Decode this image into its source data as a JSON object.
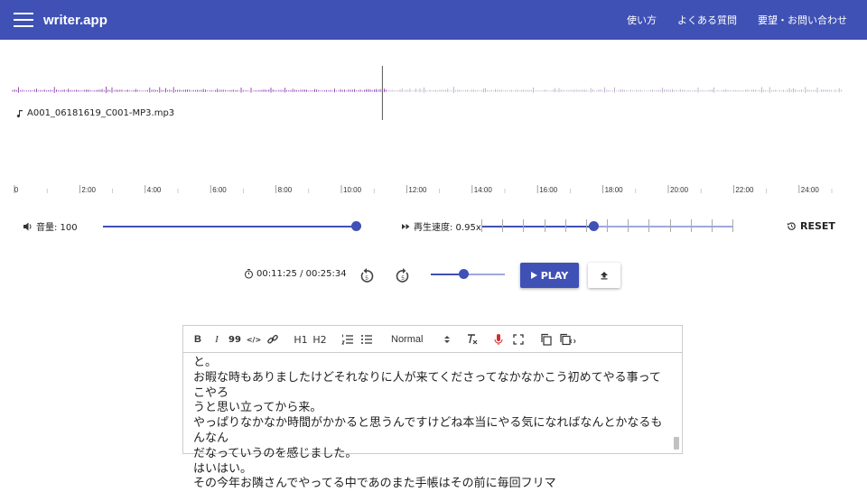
{
  "appbar": {
    "brand": "writer.app",
    "nav": [
      "使い方",
      "よくある質問",
      "要望・お問い合わせ"
    ]
  },
  "player": {
    "filename": "A001_06181619_C001-MP3.mp3",
    "timeline_labels": [
      "0",
      "2:00",
      "4:00",
      "6:00",
      "8:00",
      "10:00",
      "12:00",
      "14:00",
      "16:00",
      "18:00",
      "20:00",
      "22:00",
      "24:00"
    ],
    "volume_label": "音量: 100",
    "volume_value": 100,
    "speed_label": "再生速度: 0.95x",
    "speed_value": 0.95,
    "reset_label": "RESET",
    "time_display": "00:11:25 / 00:25:34",
    "play_label": "PLAY",
    "playhead_position": 0.446,
    "mini_slider_value": 0.44
  },
  "editor": {
    "toolbar": {
      "bold": "B",
      "italic": "I",
      "quote": "99",
      "code": "</>",
      "h1": "H1",
      "h2": "H2",
      "format_select": "Normal"
    },
    "lines": [
      "と。",
      "お暇な時もありましたけどそれなりに人が来てくださってなかなかこう初めてやる事ってこやろ",
      "うと思い立ってから来。",
      "やっぱりなかなか時間がかかると思うんですけどね本当にやる気になればなんとかなるもんなん",
      "だなっていうのを感じました。",
      "はいはい。",
      "その今年お隣さんでやってる中であのまた手帳はその前に毎回フリマ"
    ]
  },
  "colors": {
    "primary": "#3f51b5",
    "waveform": "#7b1fa2",
    "mic": "#d32f2f"
  },
  "icons": [
    "menu-icon",
    "music-note-icon",
    "volume-icon",
    "fast-forward-icon",
    "reset-icon",
    "timer-icon",
    "replay-5-icon",
    "forward-5-icon",
    "play-icon",
    "upload-icon",
    "link-icon",
    "ordered-list-icon",
    "bullet-list-icon",
    "clear-format-icon",
    "mic-icon",
    "fullscreen-icon",
    "copy-icon",
    "copy-code-icon"
  ]
}
